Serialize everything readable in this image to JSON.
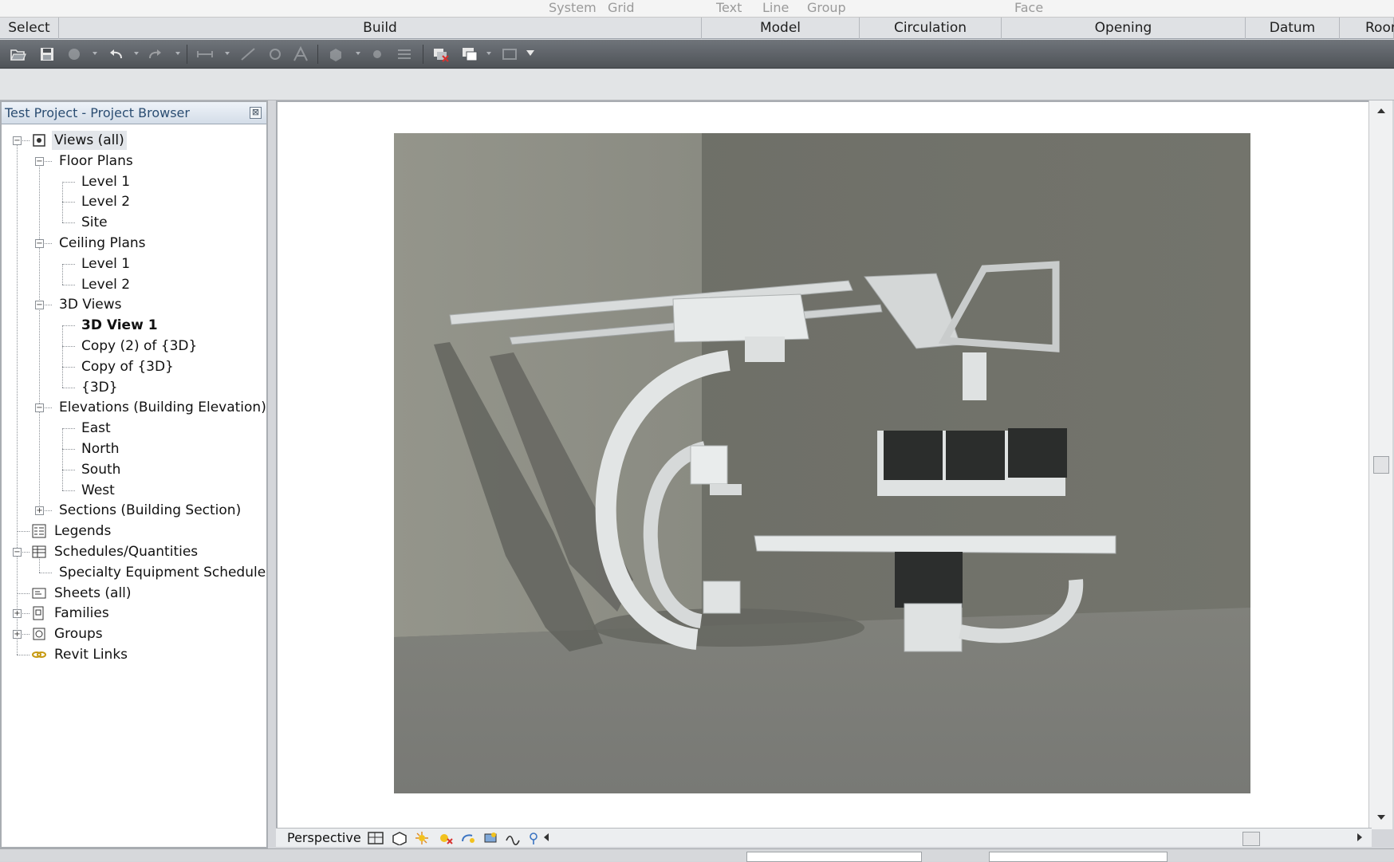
{
  "ribbon": {
    "top_labels": [
      "System",
      "Grid",
      "Text",
      "Line",
      "Group",
      "Face"
    ],
    "panels": [
      "Select",
      "Build",
      "Model",
      "Circulation",
      "Opening",
      "Datum",
      "Roor"
    ]
  },
  "project_browser": {
    "title": "Test Project - Project Browser",
    "close_glyph": "⊠",
    "items": [
      {
        "label": "Views (all)",
        "level": 0,
        "expander": "minus",
        "icon": "views-icon"
      },
      {
        "label": "Floor Plans",
        "level": 1,
        "expander": "minus"
      },
      {
        "label": "Level 1",
        "level": 2
      },
      {
        "label": "Level 2",
        "level": 2
      },
      {
        "label": "Site",
        "level": 2
      },
      {
        "label": "Ceiling Plans",
        "level": 1,
        "expander": "minus"
      },
      {
        "label": "Level 1",
        "level": 2
      },
      {
        "label": "Level 2",
        "level": 2
      },
      {
        "label": "3D Views",
        "level": 1,
        "expander": "minus"
      },
      {
        "label": "3D View 1",
        "level": 2,
        "bold": true
      },
      {
        "label": "Copy (2) of {3D}",
        "level": 2
      },
      {
        "label": "Copy of {3D}",
        "level": 2
      },
      {
        "label": "{3D}",
        "level": 2
      },
      {
        "label": "Elevations (Building Elevation)",
        "level": 1,
        "expander": "minus"
      },
      {
        "label": "East",
        "level": 2
      },
      {
        "label": "North",
        "level": 2
      },
      {
        "label": "South",
        "level": 2
      },
      {
        "label": "West",
        "level": 2
      },
      {
        "label": "Sections (Building Section)",
        "level": 1,
        "expander": "plus"
      },
      {
        "label": "Legends",
        "level": 0,
        "icon": "legends-icon"
      },
      {
        "label": "Schedules/Quantities",
        "level": 0,
        "expander": "minus",
        "icon": "schedules-icon"
      },
      {
        "label": "Specialty Equipment Schedule",
        "level": 1
      },
      {
        "label": "Sheets (all)",
        "level": 0,
        "icon": "sheets-icon"
      },
      {
        "label": "Families",
        "level": 0,
        "expander": "plus",
        "icon": "families-icon"
      },
      {
        "label": "Groups",
        "level": 0,
        "expander": "plus",
        "icon": "groups-icon"
      },
      {
        "label": "Revit Links",
        "level": 0,
        "icon": "revit-links-icon"
      }
    ]
  },
  "view_control_bar": {
    "view_type": "Perspective"
  },
  "colors": {
    "wall_left": "#8e8f86",
    "wall_right": "#707169",
    "floor": "#7d7e79",
    "equipment": "#e3e6e6",
    "panel_glass": "#2b2d2c"
  }
}
